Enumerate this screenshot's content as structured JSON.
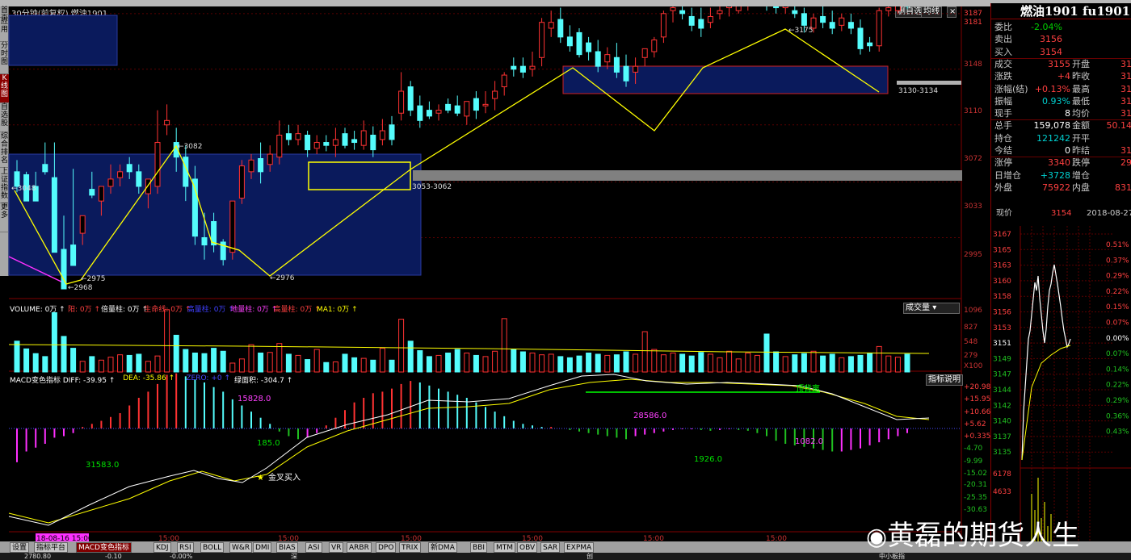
{
  "window_title": "30分钟(前复权)  燃油1901",
  "top_buttons": {
    "dehide": "删自选",
    "junxian": "均线"
  },
  "left_nav": [
    "首页",
    "应用",
    "分时图",
    "K线图",
    "自选股",
    "综合排名",
    "上证指数",
    "更多"
  ],
  "price_axis": [
    "3187",
    "3181",
    "3148",
    "3110",
    "3072",
    "3033",
    "2995"
  ],
  "price_labels": {
    "p3048": "3048",
    "p3082": "3082",
    "p2975": "2975",
    "p2968": "2968",
    "p2976": "2976",
    "p3175": "3175",
    "zone1": "3053-3062",
    "zone2": "3130-3134"
  },
  "volume": {
    "header": [
      {
        "text": "VOLUME: 0万",
        "color": "#ffffff"
      },
      {
        "text": "阳: 0万",
        "color": "#ff4040"
      },
      {
        "text": "倍量柱: 0万",
        "color": "#ffffff"
      },
      {
        "text": "生命线: 0万",
        "color": "#ff4040"
      },
      {
        "text": "高量柱: 0万",
        "color": "#4040ff"
      },
      {
        "text": "地量柱: 0万",
        "color": "#ff40ff"
      },
      {
        "text": "高量柱: 0万",
        "color": "#ff4040"
      },
      {
        "text": "MA1: 0万",
        "color": "#ffff00"
      }
    ],
    "dropdown": "成交量",
    "axis": [
      "1096",
      "827",
      "548",
      "279",
      "X100"
    ]
  },
  "macd": {
    "header": [
      {
        "text": "MACD变色指标 DIFF: -39.95",
        "color": "#ffffff"
      },
      {
        "text": "DEA: -35.86",
        "color": "#ffff00"
      },
      {
        "text": "ZERO: +0",
        "color": "#4a4aff"
      },
      {
        "text": "绿面积: -304.7",
        "color": "#ffffff"
      }
    ],
    "button": "指标说明",
    "labels": {
      "a": "15828.0",
      "b": "28586.0",
      "c": "185.0",
      "d": "31583.0",
      "e": "1926.0",
      "f": "1082.0",
      "golden": "金叉买入",
      "divergence": "顶背离"
    },
    "axis": [
      "+20.98",
      "+15.95",
      "+10.66",
      "+5.62",
      "+0.335",
      "-4.70",
      "-9.99",
      "-15.02",
      "-20.31",
      "-25.35",
      "-30.63"
    ]
  },
  "time_axis": {
    "start": "18-08-16 15:00",
    "ticks": [
      "15:00",
      "15:00",
      "15:00",
      "15:00",
      "15:00",
      "15:00"
    ]
  },
  "right_panel": {
    "title": "燃油1901 fu1901",
    "rows": [
      {
        "l": "委比",
        "v": "-2.04%",
        "vc": "#00d000"
      },
      {
        "l": "卖出",
        "v": "3156",
        "vc": "#ff4040"
      },
      {
        "l": "买入",
        "v": "3154",
        "vc": "#ff4040"
      },
      {
        "l": "成交",
        "v": "3155",
        "vc": "#ff4040",
        "l2": "开盘",
        "v2": "31"
      },
      {
        "l": "涨跌",
        "v": "+4",
        "vc": "#ff4040",
        "l2": "昨收",
        "v2": "31"
      },
      {
        "l": "涨幅(结)",
        "v": "+0.13%",
        "vc": "#ff4040",
        "l2": "最高",
        "v2": "31"
      },
      {
        "l": "振幅",
        "v": "0.93%",
        "vc": "#00d0d0",
        "l2": "最低",
        "v2": "31"
      },
      {
        "l": "现手",
        "v": "8",
        "vc": "#ffffff",
        "l2": "均价",
        "v2": "31"
      },
      {
        "l": "总手",
        "v": "159,078",
        "vc": "#ffffff",
        "l2": "金额",
        "v2": "50.14"
      },
      {
        "l": "持仓",
        "v": "121242",
        "vc": "#00d0d0",
        "l2": "开平",
        "v2": ""
      },
      {
        "l": "今结",
        "v": "0",
        "vc": "#ffffff",
        "l2": "昨结",
        "v2": "31"
      },
      {
        "l": "涨停",
        "v": "3340",
        "vc": "#ff4040",
        "l2": "跌停",
        "v2": "29"
      },
      {
        "l": "日增仓",
        "v": "+3728",
        "vc": "#00d0d0",
        "l2": "增仓",
        "v2": ""
      },
      {
        "l": "外盘",
        "v": "75922",
        "vc": "#ff4040",
        "l2": "内盘",
        "v2": "831"
      }
    ],
    "trade_row": {
      "label": "现价",
      "price": "3154",
      "date": "2018-08-27"
    },
    "mini_prices": [
      "3167",
      "3165",
      "3163",
      "3160",
      "3158",
      "3156",
      "3153",
      "3151",
      "3149",
      "3147",
      "3144",
      "3142",
      "3140",
      "3137",
      "3135"
    ],
    "mini_pcts": [
      "0.51%",
      "0.37%",
      "0.29%",
      "0.22%",
      "0.15%",
      "0.07%",
      "0.00%",
      "0.07%",
      "0.14%",
      "0.22%",
      "0.29%",
      "0.36%",
      "0.43%"
    ],
    "mini_vols": [
      "6178",
      "4633"
    ]
  },
  "tabs": [
    "设置",
    "指标平台",
    "MACD变色指标",
    "KDJ",
    "RSI",
    "BOLL",
    "W&R",
    "DMI",
    "BIAS",
    "ASI",
    "VR",
    "ARBR",
    "DPO",
    "TRIX",
    "新DMA",
    "BBI",
    "MTM",
    "OBV",
    "SAR",
    "EXPMA"
  ],
  "active_tab": "MACD变色指标",
  "status": [
    "2780.80",
    "-0.10",
    "-0.00%",
    "深",
    "创",
    "中小板指"
  ],
  "watermark": "黄磊的期货人生",
  "chart_data": {
    "type": "candlestick",
    "candles": [
      [
        3040,
        3048,
        3030,
        3026
      ],
      [
        3038,
        3040,
        3020,
        3020
      ],
      [
        3030,
        3040,
        3020,
        3028
      ],
      [
        3045,
        3060,
        3040,
        3038
      ],
      [
        3036,
        3060,
        2985,
        2985
      ],
      [
        2987,
        3010,
        2960,
        2970
      ],
      [
        2990,
        3042,
        2976,
        2980
      ],
      [
        2998,
        3002,
        3010,
        2990
      ],
      [
        3028,
        3040,
        3024,
        3022
      ],
      [
        3020,
        3030,
        3030,
        3010
      ],
      [
        3030,
        3045,
        3035,
        3025
      ],
      [
        3036,
        3045,
        3040,
        3030
      ],
      [
        3045,
        3050,
        3040,
        3035
      ],
      [
        3040,
        3045,
        3030,
        3025
      ],
      [
        3025,
        3030,
        3035,
        3015
      ],
      [
        3030,
        3082,
        3060,
        3025
      ],
      [
        3072,
        3086,
        3075,
        3065
      ],
      [
        3060,
        3070,
        3050,
        3040
      ],
      [
        3050,
        3058,
        3030,
        3020
      ],
      [
        3035,
        3044,
        2996,
        2990
      ],
      [
        2995,
        3012,
        2990,
        2980
      ],
      [
        3006,
        3012,
        2990,
        2985
      ],
      [
        2992,
        2994,
        2980,
        2976
      ],
      [
        2985,
        2992,
        3020,
        2980
      ],
      [
        3022,
        3048,
        3044,
        3018
      ],
      [
        3040,
        3052,
        3048,
        3035
      ],
      [
        3049,
        3060,
        3040,
        3032
      ],
      [
        3045,
        3058,
        3052,
        3040
      ],
      [
        3050,
        3075,
        3065,
        3045
      ],
      [
        3066,
        3072,
        3062,
        3058
      ],
      [
        3062,
        3072,
        3066,
        3058
      ],
      [
        3065,
        3068,
        3055,
        3050
      ],
      [
        3056,
        3065,
        3060,
        3052
      ],
      [
        3060,
        3065,
        3058,
        3054
      ],
      [
        3058,
        3070,
        3062,
        3050
      ],
      [
        3066,
        3070,
        3058,
        3056
      ],
      [
        3062,
        3068,
        3060,
        3055
      ],
      [
        3058,
        3075,
        3068,
        3055
      ],
      [
        3065,
        3071,
        3055,
        3050
      ],
      [
        3062,
        3076,
        3068,
        3058
      ],
      [
        3072,
        3078,
        3062,
        3058
      ],
      [
        3080,
        3108,
        3095,
        3075
      ],
      [
        3098,
        3102,
        3082,
        3078
      ],
      [
        3085,
        3092,
        3075,
        3070
      ],
      [
        3082,
        3088,
        3078,
        3076
      ],
      [
        3080,
        3086,
        3082,
        3075
      ],
      [
        3086,
        3090,
        3082,
        3080
      ],
      [
        3085,
        3092,
        3080,
        3078
      ],
      [
        3078,
        3086,
        3088,
        3072
      ],
      [
        3090,
        3095,
        3082,
        3076
      ],
      [
        3085,
        3095,
        3086,
        3080
      ],
      [
        3090,
        3102,
        3095,
        3082
      ],
      [
        3098,
        3108,
        3106,
        3092
      ],
      [
        3112,
        3118,
        3110,
        3105
      ],
      [
        3112,
        3118,
        3108,
        3104
      ],
      [
        3110,
        3122,
        3112,
        3105
      ],
      [
        3118,
        3145,
        3142,
        3112
      ],
      [
        3138,
        3150,
        3142,
        3132
      ],
      [
        3144,
        3152,
        3132,
        3128
      ],
      [
        3132,
        3140,
        3126,
        3122
      ],
      [
        3135,
        3138,
        3120,
        3118
      ],
      [
        3128,
        3132,
        3122,
        3116
      ],
      [
        3122,
        3130,
        3112,
        3108
      ],
      [
        3115,
        3125,
        3120,
        3110
      ],
      [
        3118,
        3128,
        3108,
        3104
      ],
      [
        3112,
        3120,
        3102,
        3098
      ],
      [
        3108,
        3118,
        3112,
        3100
      ],
      [
        3118,
        3124,
        3124,
        3112
      ],
      [
        3122,
        3132,
        3130,
        3118
      ],
      [
        3132,
        3150,
        3148,
        3128
      ],
      [
        3150,
        3158,
        3152,
        3142
      ],
      [
        3150,
        3154,
        3148,
        3144
      ],
      [
        3146,
        3152,
        3140,
        3136
      ],
      [
        3144,
        3152,
        3138,
        3132
      ],
      [
        3142,
        3152,
        3146,
        3138
      ],
      [
        3148,
        3158,
        3150,
        3144
      ],
      [
        3152,
        3165,
        3158,
        3146
      ],
      [
        3150,
        3158,
        3158,
        3148
      ],
      [
        3156,
        3163,
        3162,
        3150
      ],
      [
        3160,
        3175,
        3168,
        3155
      ],
      [
        3166,
        3172,
        3158,
        3150
      ],
      [
        3160,
        3168,
        3152,
        3148
      ],
      [
        3152,
        3162,
        3158,
        3148
      ],
      [
        3150,
        3158,
        3148,
        3145
      ],
      [
        3148,
        3152,
        3140,
        3135
      ],
      [
        3138,
        3148,
        3145,
        3135
      ],
      [
        3146,
        3154,
        3142,
        3138
      ],
      [
        3142,
        3150,
        3138,
        3134
      ],
      [
        3140,
        3148,
        3145,
        3136
      ],
      [
        3142,
        3148,
        3138,
        3134
      ],
      [
        3138,
        3144,
        3124,
        3120
      ],
      [
        3128,
        3132,
        3126,
        3122
      ],
      [
        3126,
        3152,
        3150,
        3122
      ],
      [
        3150,
        3158,
        3152,
        3146
      ],
      [
        3150,
        3158,
        3156,
        3148
      ],
      [
        3156,
        3158,
        3153,
        3151
      ]
    ],
    "volumes": [
      520,
      390,
      310,
      260,
      1000,
      600,
      400,
      180,
      260,
      200,
      250,
      290,
      280,
      300,
      180,
      270,
      1050,
      620,
      380,
      320,
      310,
      400,
      350,
      150,
      220,
      460,
      320,
      330,
      480,
      300,
      280,
      210,
      380,
      160,
      170,
      300,
      240,
      230,
      200,
      400,
      200,
      890,
      520,
      360,
      260,
      280,
      320,
      380,
      320,
      280,
      260,
      350,
      900,
      380,
      340,
      320,
      290,
      300,
      260,
      240,
      270,
      320,
      300,
      280,
      290,
      340,
      300,
      680,
      380,
      290,
      320,
      300,
      270,
      330,
      300,
      240,
      350,
      220,
      320,
      280,
      640,
      340,
      260,
      290,
      310,
      350,
      270,
      300,
      240,
      260,
      280,
      320,
      430,
      270,
      250,
      300
    ]
  }
}
